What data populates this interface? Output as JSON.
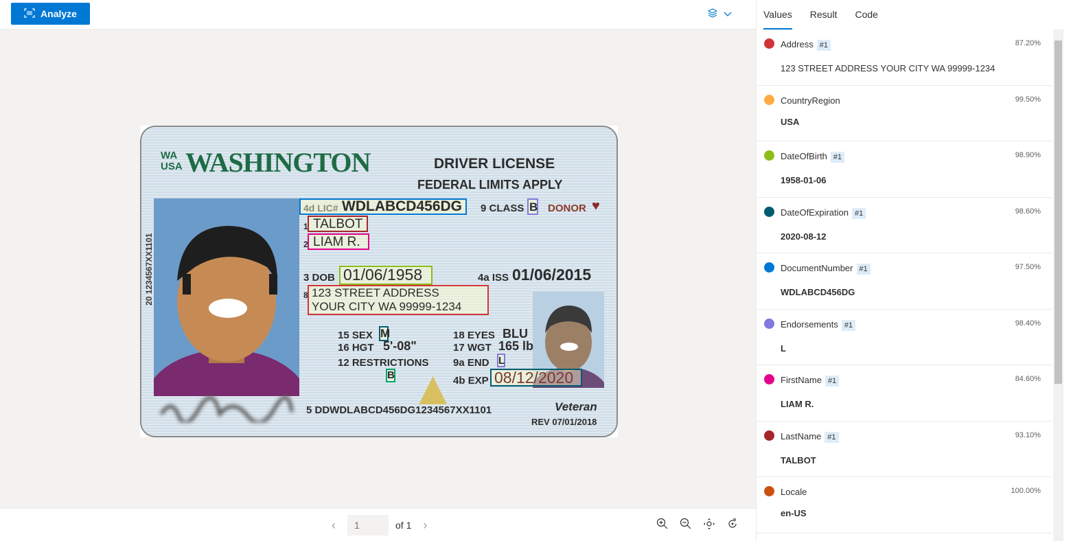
{
  "toolbar": {
    "analyze_label": "Analyze"
  },
  "card": {
    "state_abbrev": "WA\nUSA",
    "state": "WASHINGTON",
    "license_type": "DRIVER LICENSE",
    "limits": "FEDERAL LIMITS APPLY",
    "lic_prefix": "4d LIC#",
    "lic_number": "WDLABCD456DG",
    "class_label": "9 CLASS",
    "class_value": "B",
    "donor": "DONOR",
    "last_prefix": "1",
    "last_name": "TALBOT",
    "first_prefix": "2",
    "first_name": "LIAM R.",
    "dob_label": "3 DOB",
    "dob": "01/06/1958",
    "iss_label": "4a ISS",
    "iss": "01/06/2015",
    "addr_prefix": "8",
    "addr_line1": "123 STREET ADDRESS",
    "addr_line2": "YOUR CITY WA 99999-1234",
    "sex_label": "15 SEX",
    "sex": "M",
    "hgt_label": "16 HGT",
    "hgt": "5'-08\"",
    "restrictions_label": "12 RESTRICTIONS",
    "restrictions_value": "B",
    "eyes_label": "18 EYES",
    "eyes": "BLU",
    "wgt_label": "17 WGT",
    "wgt": "165 lb",
    "end_label": "9a END",
    "end": "L",
    "exp_label": "4b EXP",
    "exp": "08/12/2020",
    "side_number": "20 1234567XX1101",
    "dd": "5 DDWDLABCD456DG1234567XX1101",
    "veteran": "Veteran",
    "rev": "REV 07/01/2018"
  },
  "pager": {
    "page_placeholder": "1",
    "of_label": "of 1"
  },
  "tabs": [
    "Values",
    "Result",
    "Code"
  ],
  "fields": [
    {
      "name": "Address",
      "badge": "#1",
      "confidence": "87.20%",
      "value": "123 STREET ADDRESS YOUR CITY WA 99999-1234",
      "color": "#d13438"
    },
    {
      "name": "CountryRegion",
      "badge": "",
      "confidence": "99.50%",
      "value": "USA",
      "color": "#ffaa44"
    },
    {
      "name": "DateOfBirth",
      "badge": "#1",
      "confidence": "98.90%",
      "value": "1958-01-06",
      "color": "#8cbd18"
    },
    {
      "name": "DateOfExpiration",
      "badge": "#1",
      "confidence": "98.60%",
      "value": "2020-08-12",
      "color": "#005b70"
    },
    {
      "name": "DocumentNumber",
      "badge": "#1",
      "confidence": "97.50%",
      "value": "WDLABCD456DG",
      "color": "#0078d4"
    },
    {
      "name": "Endorsements",
      "badge": "#1",
      "confidence": "98.40%",
      "value": "L",
      "color": "#8378de"
    },
    {
      "name": "FirstName",
      "badge": "#1",
      "confidence": "84.60%",
      "value": "LIAM R.",
      "color": "#e3008c"
    },
    {
      "name": "LastName",
      "badge": "#1",
      "confidence": "93.10%",
      "value": "TALBOT",
      "color": "#a4262c"
    },
    {
      "name": "Locale",
      "badge": "",
      "confidence": "100.00%",
      "value": "en-US",
      "color": "#ca5010"
    }
  ]
}
